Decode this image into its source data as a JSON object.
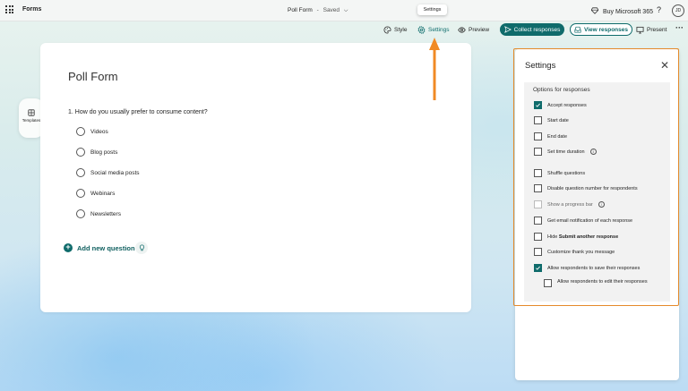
{
  "app": {
    "name": "Forms"
  },
  "header": {
    "form_title": "Poll Form",
    "separator": "-",
    "save_status": "Saved",
    "buy_label": "Buy Microsoft 365",
    "help_label": "?",
    "avatar_initials": "JD"
  },
  "tooltip": {
    "text": "Settings"
  },
  "toolbar": {
    "style_label": "Style",
    "settings_label": "Settings",
    "preview_label": "Preview",
    "collect_label": "Collect responses",
    "view_label": "View responses",
    "present_label": "Present",
    "more_label": "···"
  },
  "templates": {
    "label": "Templates"
  },
  "form": {
    "title": "Poll Form",
    "question": "1. How do you usually prefer to consume content?",
    "options": [
      "Videos",
      "Blog posts",
      "Social media posts",
      "Webinars",
      "Newsletters"
    ],
    "add_question_label": "Add new question"
  },
  "settings": {
    "title": "Settings",
    "section_title": "Options for responses",
    "options": [
      {
        "label": "Accept responses",
        "checked": true
      },
      {
        "label": "Start date",
        "checked": false
      },
      {
        "label": "End date",
        "checked": false
      },
      {
        "label": "Set time duration",
        "checked": false,
        "info": true
      },
      {
        "label": "Shuffle questions",
        "checked": false
      },
      {
        "label": "Disable question number for respondents",
        "checked": false
      },
      {
        "label": "Show a progress bar",
        "checked": false,
        "info": true,
        "disabled": true
      },
      {
        "label": "Get email notification of each response",
        "checked": false
      },
      {
        "label_prefix": "Hide ",
        "label_bold": "Submit another response",
        "checked": false
      },
      {
        "label": "Customize thank you message",
        "checked": false
      },
      {
        "label": "Allow respondents to save their responses",
        "checked": true
      },
      {
        "label": "Allow respondents to edit their responses",
        "checked": false,
        "sub": true
      }
    ]
  },
  "colors": {
    "accent": "#0f6b6b",
    "highlight": "#e58a2a"
  }
}
